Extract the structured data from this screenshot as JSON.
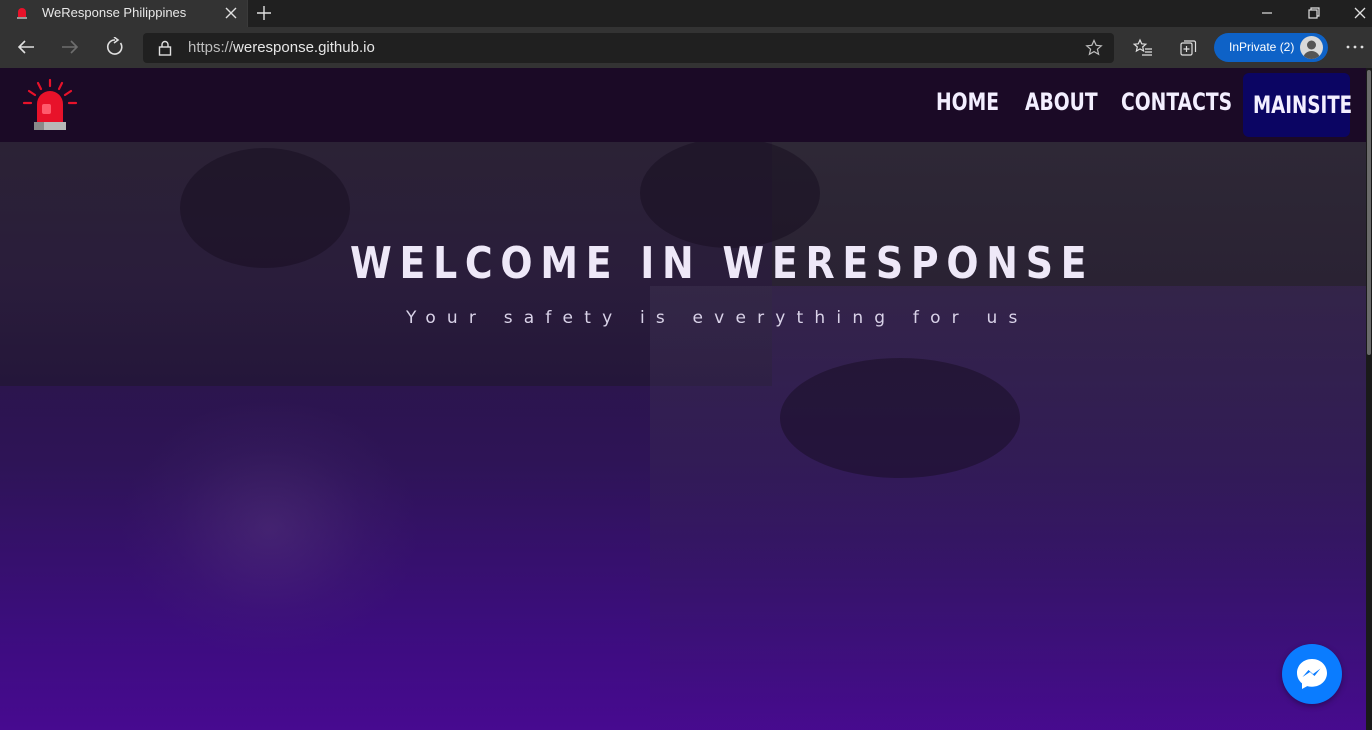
{
  "browser": {
    "tab": {
      "title": "WeResponse Philippines",
      "favicon": "alarm-siren-icon"
    },
    "address": {
      "scheme": "https://",
      "host": "weresponse.github.io"
    },
    "inprivate_label": "InPrivate (2)"
  },
  "site": {
    "nav": [
      {
        "label": "HOME"
      },
      {
        "label": "ABOUT"
      },
      {
        "label": "CONTACTS"
      },
      {
        "label": "MAINSITE"
      }
    ],
    "hero": {
      "title": "WELCOME IN WERESPONSE",
      "subtitle": "Your safety is everything for us"
    }
  },
  "colors": {
    "header_bg": "#1b0a26",
    "mainsite_bg": "#0b0563",
    "accent_red": "#e8122a",
    "messenger_blue": "#0a7cff"
  }
}
